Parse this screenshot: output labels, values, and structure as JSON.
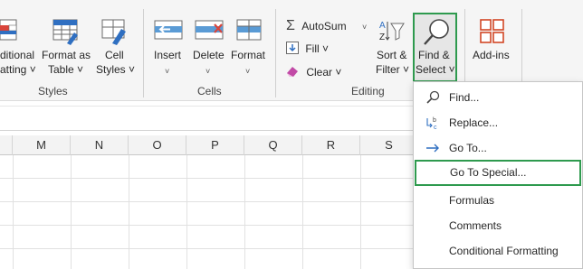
{
  "ribbon": {
    "styles_group": {
      "label": "Styles",
      "conditional": {
        "line1": "ditional",
        "line2": "atting ˅"
      },
      "format_as_table": {
        "line1": "Format as",
        "line2": "Table ˅"
      },
      "cell_styles": {
        "line1": "Cell",
        "line2": "Styles ˅"
      }
    },
    "cells_group": {
      "label": "Cells",
      "insert": {
        "line1": "Insert",
        "line2": "˅"
      },
      "delete": {
        "line1": "Delete",
        "line2": "˅"
      },
      "format": {
        "line1": "Format",
        "line2": "˅"
      }
    },
    "editing_group": {
      "label": "Editing",
      "autosum": "AutoSum",
      "autosum_chev": "˅",
      "fill": "Fill ˅",
      "clear": "Clear ˅",
      "sort_filter": {
        "line1": "Sort &",
        "line2": "Filter ˅"
      },
      "find_select": {
        "line1": "Find &",
        "line2": "Select ˅"
      }
    },
    "addins": {
      "label": "Add-ins"
    }
  },
  "sheet": {
    "columns": [
      "M",
      "N",
      "O",
      "P",
      "Q",
      "R",
      "S"
    ]
  },
  "find_menu": {
    "items": [
      {
        "label": "Find...",
        "icon": "search-icon"
      },
      {
        "label": "Replace...",
        "icon": "replace-icon"
      },
      {
        "label": "Go To...",
        "icon": "arrow-right-icon"
      },
      {
        "label": "Go To Special...",
        "icon": ""
      },
      {
        "label": "Formulas",
        "icon": ""
      },
      {
        "label": "Comments",
        "icon": ""
      },
      {
        "label": "Conditional Formatting",
        "icon": ""
      }
    ]
  },
  "colors": {
    "highlight": "#2e9a4e",
    "accent_blue": "#2f6fc1",
    "accent_red": "#d9453b",
    "addins_orange": "#d24726"
  }
}
